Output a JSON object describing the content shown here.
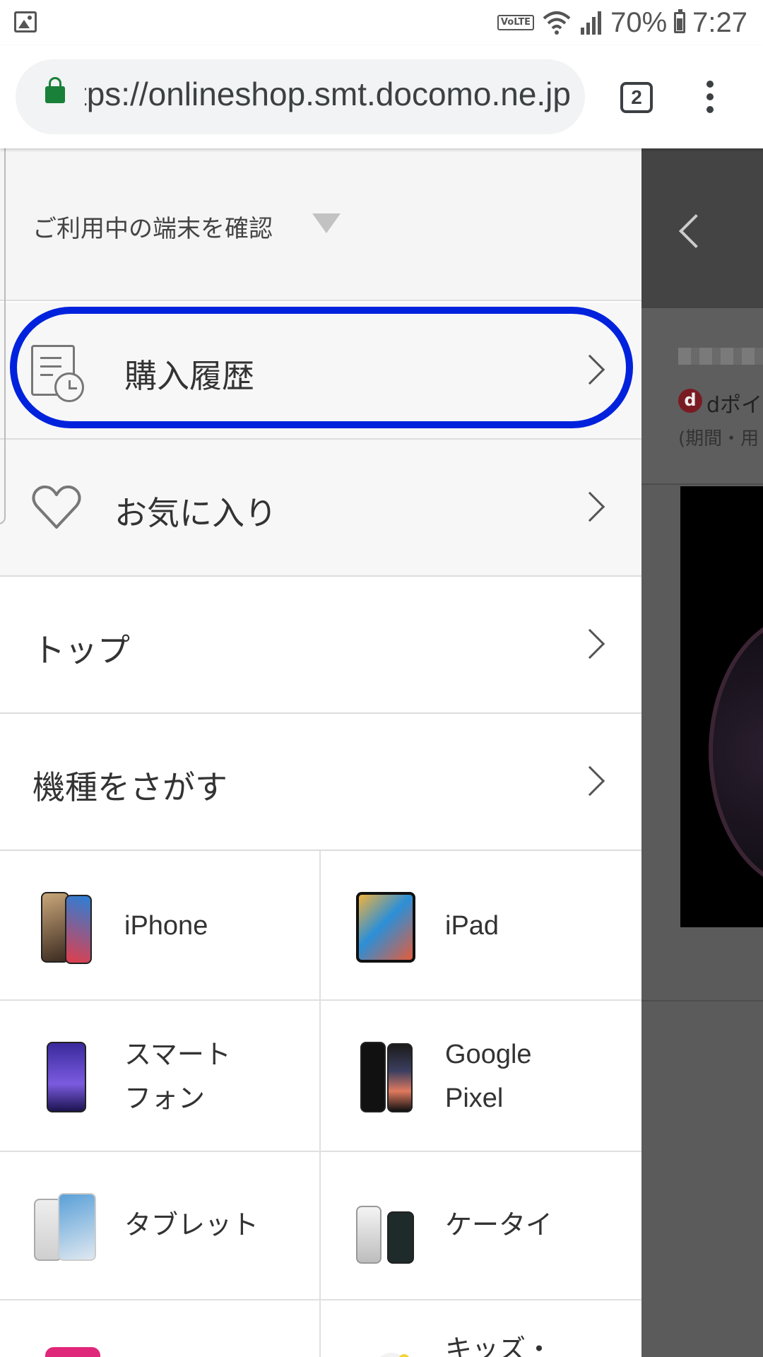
{
  "status_bar": {
    "volte": "VoLTE",
    "battery": "70%",
    "time": "7:27"
  },
  "browser": {
    "url": "https://onlineshop.smt.docomo.ne.jp",
    "tab_count": "2"
  },
  "drawer": {
    "account_label": "ご利用中の端末を確認",
    "menu": [
      {
        "label": "購入履歴",
        "icon": "purchase-history-icon"
      },
      {
        "label": "お気に入り",
        "icon": "heart-icon"
      },
      {
        "label": "トップ"
      },
      {
        "label": "機種をさがす"
      }
    ],
    "categories": [
      {
        "label": "iPhone"
      },
      {
        "label": "iPad"
      },
      {
        "label": "スマート\nフォン"
      },
      {
        "label": "Google\nPixel"
      },
      {
        "label": "タブレット"
      },
      {
        "label": "ケータイ"
      },
      {
        "label": ""
      },
      {
        "label": "キッズ・"
      }
    ]
  },
  "background_page": {
    "dpoint_text": "dポイ",
    "sub_text": "(期間・用",
    "d_icon": "d"
  },
  "colors": {
    "highlight": "#0022dd",
    "lock": "#188038",
    "dim_overlay": "#5b5b5b"
  }
}
